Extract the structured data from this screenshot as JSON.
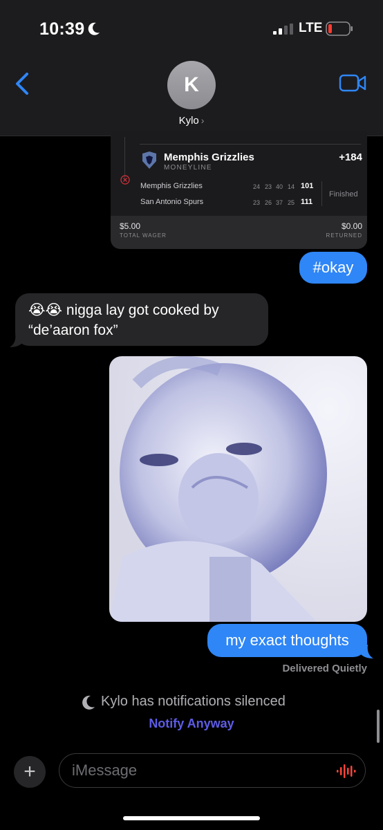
{
  "status_bar": {
    "time": "10:39",
    "network": "LTE"
  },
  "header": {
    "avatar_initial": "K",
    "contact_name": "Kylo",
    "chevron": "›"
  },
  "bet_card": {
    "team": "Memphis Grizzlies",
    "bet_type": "MONEYLINE",
    "odds": "+184",
    "rows": [
      {
        "team": "Memphis Grizzlies",
        "q1": "24",
        "q2": "23",
        "q3": "40",
        "q4": "14",
        "final": "101"
      },
      {
        "team": "San Antonio Spurs",
        "q1": "23",
        "q2": "26",
        "q3": "37",
        "q4": "25",
        "final": "111"
      }
    ],
    "result": "Finished",
    "wager_amount": "$5.00",
    "wager_label": "TOTAL WAGER",
    "returned_amount": "$0.00",
    "returned_label": "RETURNED"
  },
  "messages": {
    "okay": "#okay",
    "received_line1": "😭😭 nigga lay got cooked by",
    "received_line2": "“de’aaron fox”",
    "exact": "my exact thoughts"
  },
  "delivered": "Delivered Quietly",
  "silenced": "Kylo has notifications silenced",
  "notify_anyway": "Notify Anyway",
  "input": {
    "placeholder": "iMessage",
    "plus": "+"
  },
  "colors": {
    "blue_bubble": "#2f86f6",
    "gray_bubble": "#262628",
    "notify_link": "#5e5ce6",
    "accent": "#2f86f6"
  }
}
